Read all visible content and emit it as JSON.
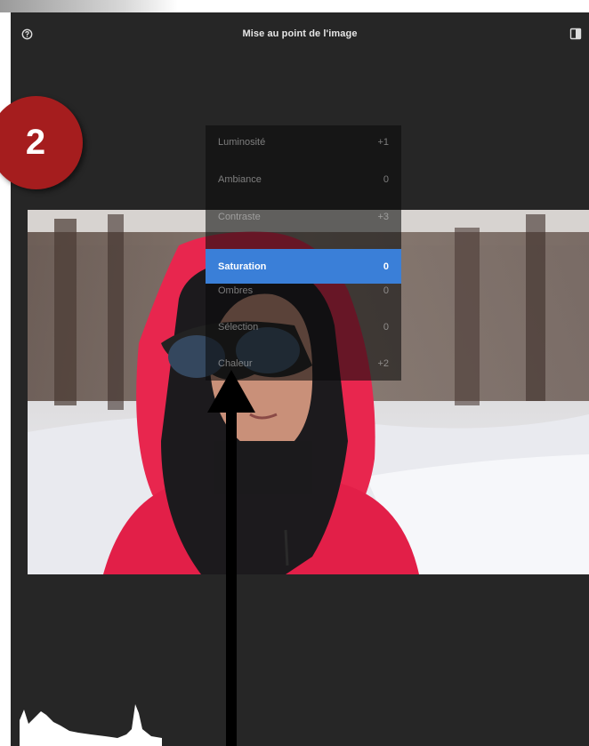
{
  "header": {
    "title": "Mise au point de l'image",
    "left_icon": "help-icon",
    "right_icon": "compare-icon"
  },
  "callout": {
    "number": "2",
    "color": "#a51d1e"
  },
  "menu": {
    "items": [
      {
        "label": "Luminosité",
        "value": "+1"
      },
      {
        "label": "Ambiance",
        "value": "0"
      },
      {
        "label": "Contraste",
        "value": "+3"
      },
      {
        "label": "Saturation",
        "value": "0",
        "selected": true
      },
      {
        "label": "Ombres",
        "value": "0"
      },
      {
        "label": "Sélection",
        "value": "0"
      },
      {
        "label": "Chaleur",
        "value": "+2"
      }
    ],
    "selected_color": "#3a7fd8"
  },
  "colors": {
    "app_background": "#262626",
    "accent": "#3a7fd8",
    "jacket": "#e8264e"
  }
}
